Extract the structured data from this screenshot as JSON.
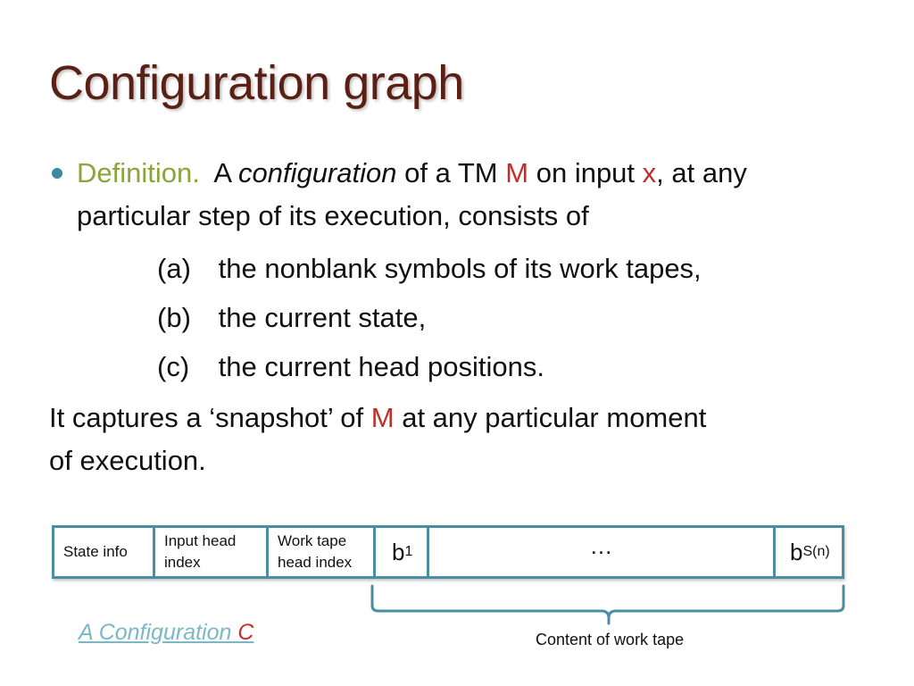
{
  "title": "Configuration graph",
  "definition": {
    "label": "Definition.",
    "text_a": "A",
    "term": "configuration",
    "text_b": "of a TM",
    "machine": "M",
    "text_c": "on input",
    "input": "x",
    "text_d": ", at any",
    "line2": "particular step of its execution, consists of"
  },
  "items": [
    {
      "label": "(a)",
      "text": "the nonblank symbols of its work tapes,"
    },
    {
      "label": "(b)",
      "text": "the current state,"
    },
    {
      "label": "(c)",
      "text": "the current head positions."
    }
  ],
  "snapshot": {
    "text_a": "It captures a ‘snapshot’ of",
    "machine": "M",
    "text_b": "at any particular moment",
    "line2": "of execution."
  },
  "tape": {
    "cells": [
      {
        "line1": "State info",
        "line2": ""
      },
      {
        "line1": "Input head",
        "line2": "index"
      },
      {
        "line1": "Work tape",
        "line2": "head index"
      }
    ],
    "b1": {
      "base": "b",
      "sub": "1"
    },
    "ellipsis": "…",
    "bsn": {
      "base": "b",
      "sub": "S(n)"
    }
  },
  "brace_label": "Content of work tape",
  "config_label": {
    "text": "A Configuration ",
    "var": "C"
  },
  "colors": {
    "title": "#5a2015",
    "definition": "#8aa53a",
    "highlight": "#c0302b",
    "tape_border": "#4a8ea3",
    "link": "#7ab8c8"
  }
}
